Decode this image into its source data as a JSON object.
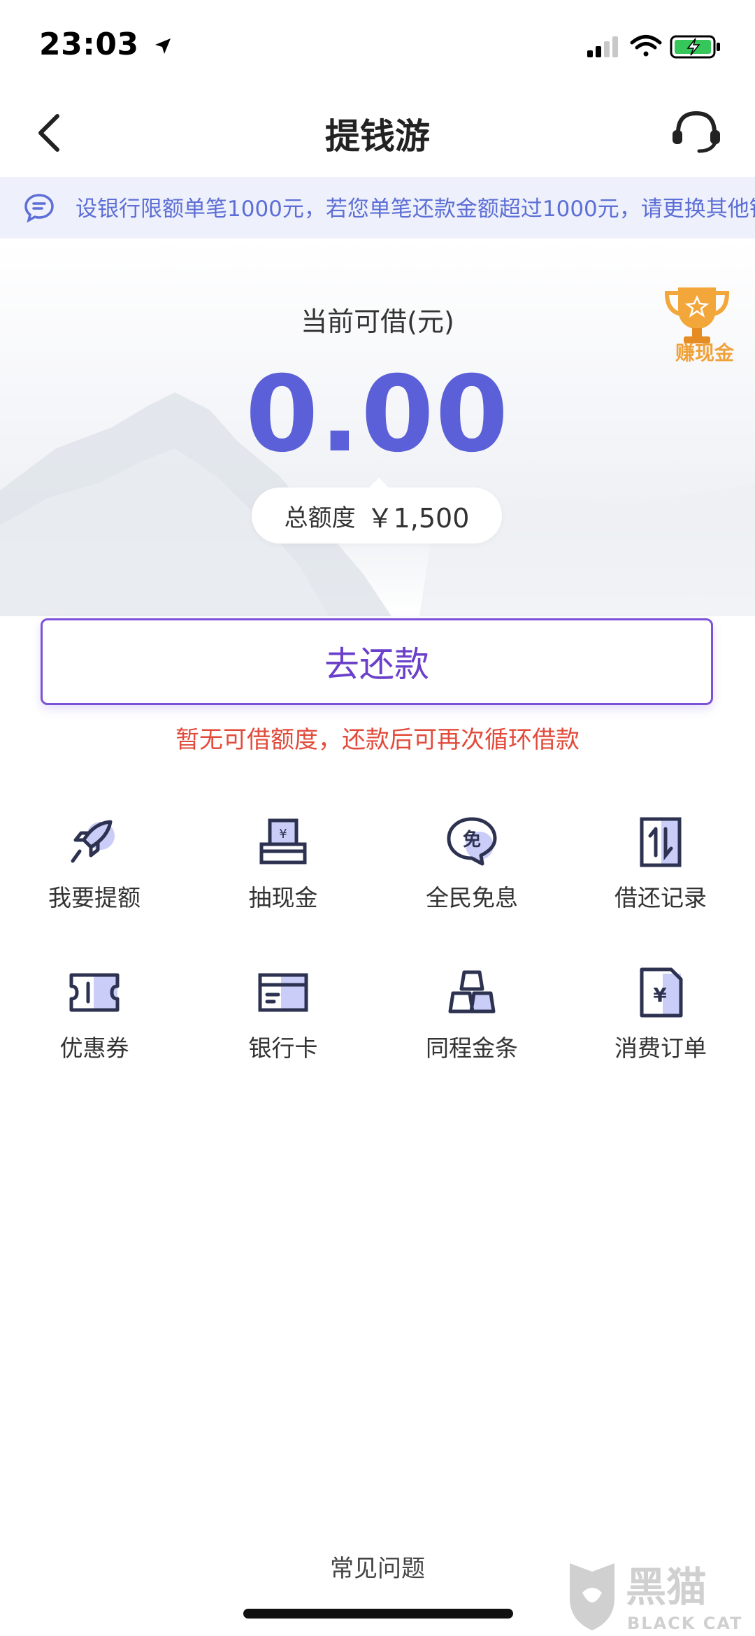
{
  "status_bar": {
    "time": "23:03"
  },
  "nav": {
    "title": "提钱游"
  },
  "notice": {
    "text": "设银行限额单笔1000元，若您单笔还款金额超过1000元，请更换其他银"
  },
  "hero": {
    "available_label": "当前可借(元)",
    "available_amount": "0.00",
    "total_label": "总额度",
    "total_value": "￥1,500",
    "reward_label": "赚现金"
  },
  "repay": {
    "button_label": "去还款",
    "tip": "暂无可借额度，还款后可再次循环借款"
  },
  "grid": [
    {
      "label": "我要提额",
      "icon": "rocket-icon"
    },
    {
      "label": "抽现金",
      "icon": "cash-draw-icon"
    },
    {
      "label": "全民免息",
      "icon": "free-interest-icon"
    },
    {
      "label": "借还记录",
      "icon": "record-icon"
    },
    {
      "label": "优惠券",
      "icon": "coupon-icon"
    },
    {
      "label": "银行卡",
      "icon": "bank-card-icon"
    },
    {
      "label": "同程金条",
      "icon": "gold-bar-icon"
    },
    {
      "label": "消费订单",
      "icon": "order-icon"
    }
  ],
  "footer": {
    "faq": "常见问题"
  },
  "watermark": {
    "text_cn": "黑猫",
    "text_en": "BLACK CAT"
  },
  "colors": {
    "accent": "#5b5fd8",
    "button": "#6a3fc9",
    "warning": "#e24b3b",
    "notice_bg": "#eef1fb"
  }
}
